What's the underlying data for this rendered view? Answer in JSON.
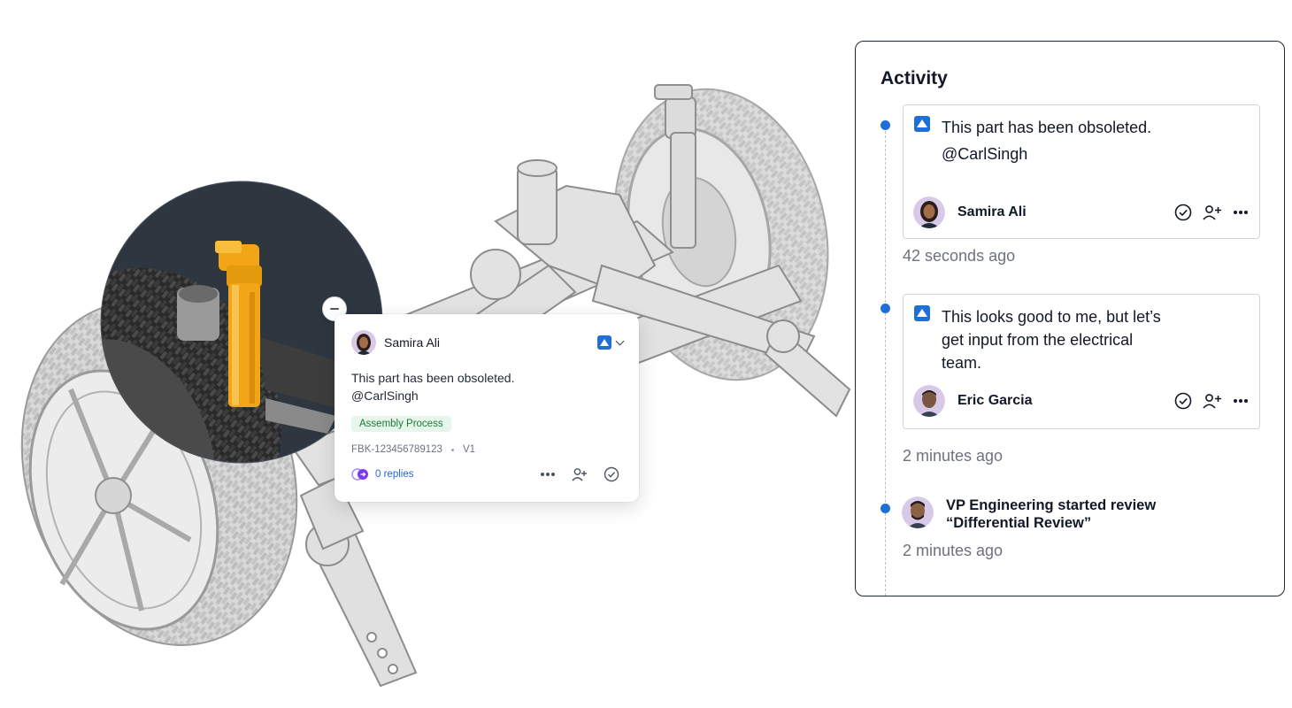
{
  "comment_card": {
    "author": "Samira Ali",
    "body_line1": "This part has been obsoleted.",
    "body_line2": "@CarlSingh",
    "tag": "Assembly Process",
    "id": "FBK-123456789123",
    "version": "V1",
    "replies": "0 replies",
    "status_icon": "triangle-icon"
  },
  "activity": {
    "title": "Activity",
    "items": [
      {
        "text_line1": "This part has been obsoleted.",
        "text_line2": "@CarlSingh",
        "user": "Samira Ali",
        "time": "42 seconds ago"
      },
      {
        "text_line1": "This looks good to me, but let’s",
        "text_line2": "get input from the electrical",
        "text_line3": "team.",
        "user": "Eric Garcia",
        "time": "2 minutes ago"
      },
      {
        "text_line1": "VP Engineering started review",
        "text_line2": "“Differential Review”",
        "time": "2 minutes ago"
      }
    ]
  },
  "colors": {
    "accent": "#1e6fd9",
    "tag_bg": "#e6f6ea",
    "tag_text": "#1f7a3a",
    "highlight_part": "#f2a516",
    "zoom_bg": "#2e3740"
  }
}
